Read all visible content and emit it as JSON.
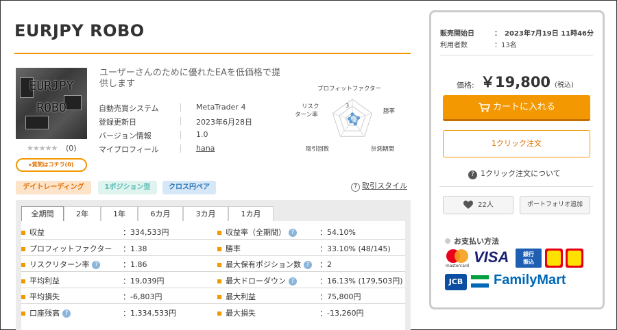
{
  "title": "EURJPY ROBO",
  "thumbnail": {
    "line1": "EURJPY",
    "line2": "ROBO"
  },
  "rating": {
    "stars": "★★★★★",
    "count": "(0)"
  },
  "question_button": "▸質問はコチラ(0)",
  "catchphrase": "ユーザーさんのために優れたEAを低価格で提供します",
  "info": [
    {
      "label": "自動売買システム",
      "value": "MetaTrader 4"
    },
    {
      "label": "登録更新日",
      "value": "2023年6月28日"
    },
    {
      "label": "バージョン情報",
      "value": "1.0"
    },
    {
      "label": "マイプロフィール",
      "value": "hana"
    }
  ],
  "radar": {
    "labels": [
      "プロフィットファクター",
      "勝率",
      "計測期間",
      "取引回数",
      "リスク\nターン率"
    ],
    "label_lines": {
      "risk1": "リスク",
      "risk2": "ターン率"
    },
    "center_value": "3",
    "values": [
      1.38,
      1.5,
      1.2,
      0.6,
      0.8
    ],
    "max": 5
  },
  "tags": [
    "デイトレーディング",
    "1ポジション型",
    "クロス円ペア"
  ],
  "style_link": "取引スタイル",
  "tabs": [
    "全期間",
    "2年",
    "1年",
    "6カ月",
    "3カ月",
    "1カ月"
  ],
  "stats_left": [
    {
      "label": "収益",
      "value": "：334,533円",
      "help": false
    },
    {
      "label": "プロフィットファクター",
      "value": "：1.38",
      "help": false
    },
    {
      "label": "リスクリターン率",
      "value": "：1.86",
      "help": true
    },
    {
      "label": "平均利益",
      "value": "：19,039円",
      "help": false
    },
    {
      "label": "平均損失",
      "value": "：-6,803円",
      "help": false
    },
    {
      "label": "口座残高",
      "value": "：1,334,533円",
      "help": true
    }
  ],
  "stats_right": [
    {
      "label": "収益率（全期間）",
      "value": "：54.10%",
      "help": true
    },
    {
      "label": "勝率",
      "value": "：33.10% (48/145)",
      "help": false
    },
    {
      "label": "最大保有ポジション数",
      "value": "：2",
      "help": true
    },
    {
      "label": "最大ドローダウン",
      "value": "：16.13% (179,503円)",
      "help": true
    },
    {
      "label": "最大利益",
      "value": "：75,800円",
      "help": false
    },
    {
      "label": "最大損失",
      "value": "：-13,260円",
      "help": false
    }
  ],
  "sidebar": {
    "release_label": "販売開始日",
    "release_value": "：　2023年7月19日 11時46分",
    "users_label": "利用者数",
    "users_value": "：13名",
    "price_label": "価格:",
    "price": "￥19,800",
    "tax": "(税込)",
    "cart_button": "カートに入れる",
    "oneclick_button": "1クリック注文",
    "oneclick_info": "1クリック注文について",
    "fav_count": "22人",
    "portfolio_button": "ポートフォリオ追加",
    "payment_title": "お支払い方法",
    "payment_logos": {
      "mastercard": "mastercard",
      "visa": "VISA",
      "bank1": "銀行",
      "bank2": "振込",
      "jcb": "JCB",
      "familymart": "FamilyMart"
    }
  },
  "colors": {
    "accent": "#f39800",
    "tag_day": "#e46f00",
    "tag_one": "#5abcb2",
    "tag_cross": "#2a74b5",
    "radar": "#5b9bd5"
  }
}
